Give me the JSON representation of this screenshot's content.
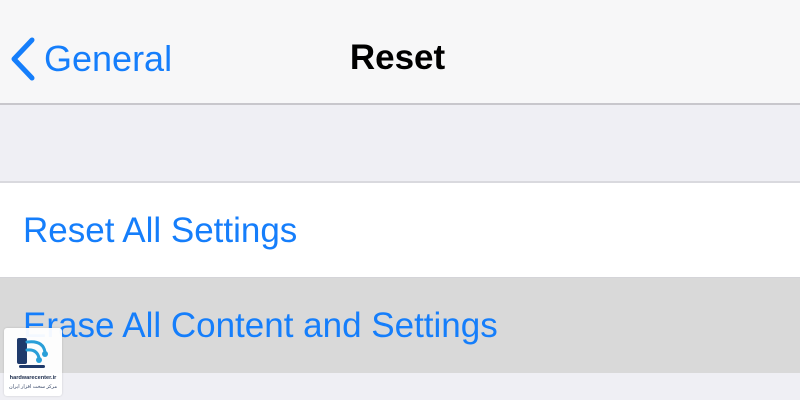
{
  "nav": {
    "back_label": "General",
    "title": "Reset"
  },
  "cells": [
    {
      "label": "Reset All Settings",
      "highlighted": false
    },
    {
      "label": "Erase All Content and Settings",
      "highlighted": true
    }
  ],
  "watermark": {
    "site": "hardwarecenter.ir",
    "tagline": "مرکز سخت افزار ایران"
  },
  "colors": {
    "accent": "#157efb",
    "nav_background": "#f7f7f8",
    "grouped_background": "#efeff4",
    "cell_background": "#ffffff",
    "cell_highlight": "#d9d9d9"
  },
  "icons": {
    "back": "chevron-left-icon",
    "watermark_logo": "hardwarecenter-logo"
  }
}
